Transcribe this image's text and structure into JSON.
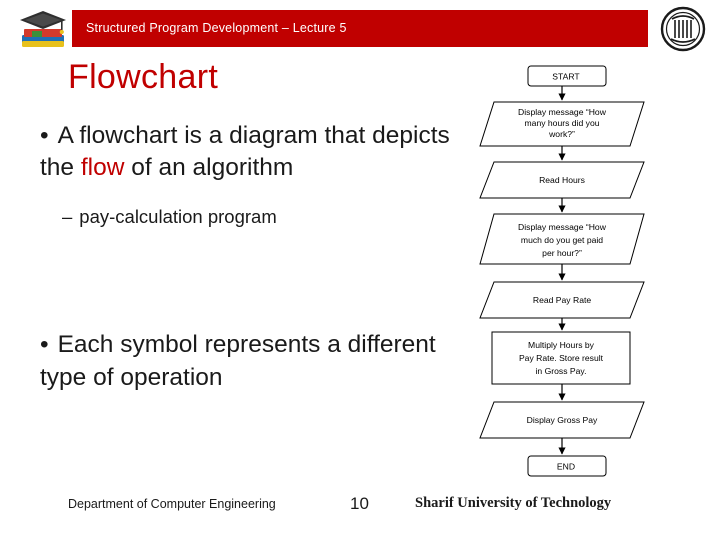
{
  "header": {
    "title": "Structured Program Development – Lecture 5",
    "bar_color": "#c00000",
    "left_logo_name": "graduation-cap-book-logo",
    "right_logo_name": "sharif-university-logo"
  },
  "slide": {
    "title": "Flowchart",
    "title_color": "#c00000",
    "bullets": [
      {
        "marker": "•",
        "text_before": "A flowchart is a diagram that depicts the ",
        "highlight": "flow",
        "text_after": " of an algorithm",
        "highlight_color": "#c00000"
      },
      {
        "marker": "•",
        "text": "Each symbol represents a different type of operation"
      }
    ],
    "subbullet": {
      "marker": "–",
      "text": "pay-calculation program"
    }
  },
  "footer": {
    "department": "Department of Computer Engineering",
    "page_number": "10",
    "university": "Sharif University of Technology"
  },
  "flowchart": {
    "shape_outline_color": "#000000",
    "shape_fill_color": "#ffffff",
    "nodes": [
      {
        "id": "start",
        "shape": "terminator",
        "label": "START"
      },
      {
        "id": "disp_hours",
        "shape": "parallelogram",
        "label": "Display message “How many hours did you work?”"
      },
      {
        "id": "read_hours",
        "shape": "parallelogram",
        "label": "Read Hours"
      },
      {
        "id": "disp_rate",
        "shape": "parallelogram",
        "label": "Display message “How much do you get paid per hour?”"
      },
      {
        "id": "read_rate",
        "shape": "parallelogram",
        "label": "Read Pay Rate"
      },
      {
        "id": "multiply",
        "shape": "process",
        "label": "Multiply Hours by Pay Rate. Store result in Gross Pay."
      },
      {
        "id": "disp_gross",
        "shape": "parallelogram",
        "label": "Display Gross Pay"
      },
      {
        "id": "end",
        "shape": "terminator",
        "label": "END"
      }
    ]
  }
}
